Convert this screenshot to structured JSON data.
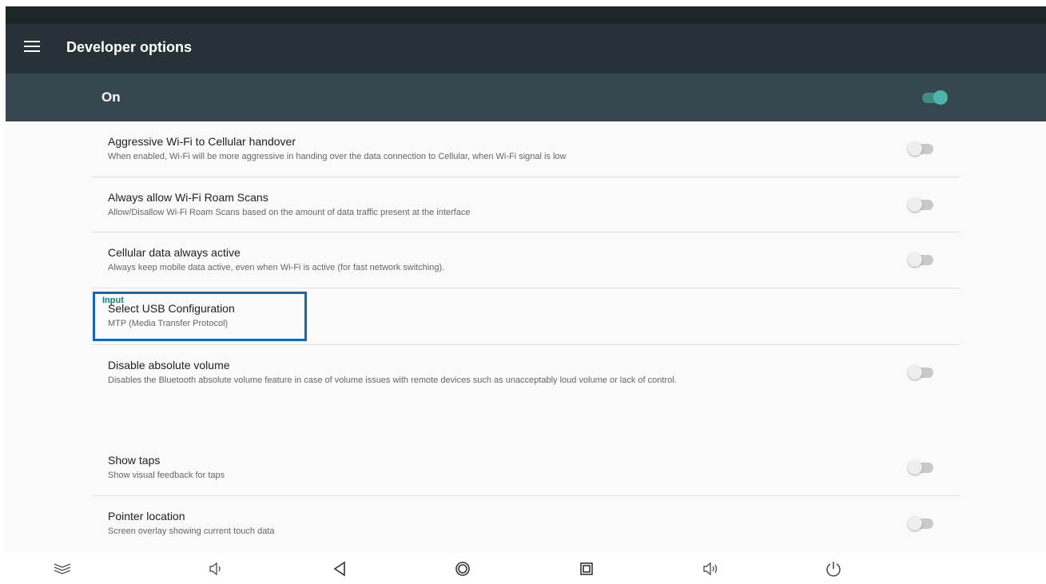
{
  "toolbar": {
    "title": "Developer options",
    "menu_icon": "menu-icon"
  },
  "master_switch": {
    "label": "On",
    "state": "on",
    "accent_color": "#4db6ac"
  },
  "items": [
    {
      "title": "Aggressive Wi-Fi to Cellular handover",
      "summary": "When enabled, Wi-Fi will be more aggressive in handing over the data connection to Cellular, when Wi-Fi signal is low",
      "toggle": "off"
    },
    {
      "title": "Always allow Wi-Fi Roam Scans",
      "summary": "Allow/Disallow Wi-Fi Roam Scans based on the amount of data traffic present at the interface",
      "toggle": "off"
    },
    {
      "title": "Cellular data always active",
      "summary": "Always keep mobile data active, even when Wi-Fi is active (for fast network switching).",
      "toggle": "off"
    },
    {
      "title": "Select USB Configuration",
      "summary": "MTP (Media Transfer Protocol)",
      "highlighted": true
    },
    {
      "title": "Disable absolute volume",
      "summary": "Disables the Bluetooth absolute volume feature in case of volume issues with remote devices such as unacceptably loud volume or lack of control.",
      "toggle": "off"
    }
  ],
  "input_category": {
    "label": "Input",
    "items": [
      {
        "title": "Show taps",
        "summary": "Show visual feedback for taps",
        "toggle": "off"
      },
      {
        "title": "Pointer location",
        "summary": "Screen overlay showing current touch data",
        "toggle": "off"
      }
    ]
  },
  "highlight_color": "#1565c0",
  "nav_bar": {
    "buttons": [
      "expand-icon",
      "volume-down-icon",
      "back-icon",
      "home-icon",
      "recents-icon",
      "volume-up-icon",
      "power-icon"
    ]
  }
}
